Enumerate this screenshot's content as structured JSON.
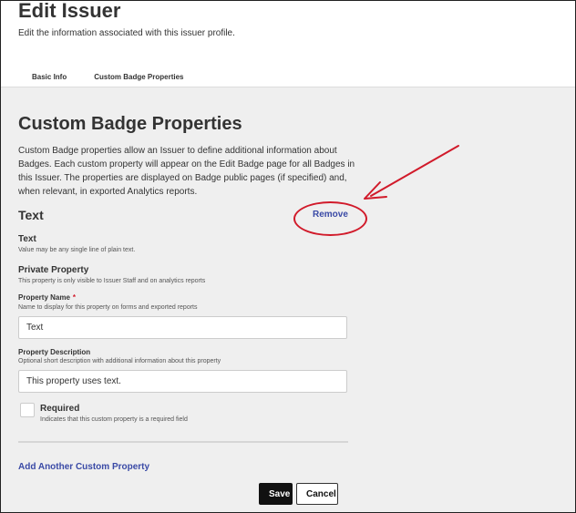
{
  "header": {
    "title": "Edit Issuer",
    "subtitle": "Edit the information associated with this issuer profile.",
    "tabs": [
      {
        "label": "Basic Info",
        "active": false
      },
      {
        "label": "Custom Badge Properties",
        "active": true
      }
    ]
  },
  "section": {
    "title": "Custom Badge Properties",
    "intro": "Custom Badge properties allow an Issuer to define additional information about Badges. Each custom property will appear on the Edit Badge page for all Badges in this Issuer. The properties are displayed on Badge public pages (if specified) and, when relevant, in exported Analytics reports."
  },
  "property": {
    "type_heading": "Text",
    "remove_label": "Remove",
    "type_label": "Text",
    "type_help": "Value may be any single line of plain text.",
    "private_label": "Private Property",
    "private_help": "This property is only visible to Issuer Staff and on analytics reports",
    "name_label": "Property Name",
    "name_required_mark": "*",
    "name_help": "Name to display for this property on forms and exported reports",
    "name_value": "Text",
    "desc_label": "Property Description",
    "desc_help": "Optional short description with additional information about this property",
    "desc_value": "This property uses text.",
    "required_label": "Required",
    "required_help": "Indicates that this custom property is a required field",
    "required_checked": false
  },
  "actions": {
    "add_label": "Add Another Custom Property",
    "save_label": "Save",
    "cancel_label": "Cancel"
  },
  "colors": {
    "link": "#3a4aa6",
    "annotation": "#d11a2a",
    "content_bg": "#efefef"
  }
}
